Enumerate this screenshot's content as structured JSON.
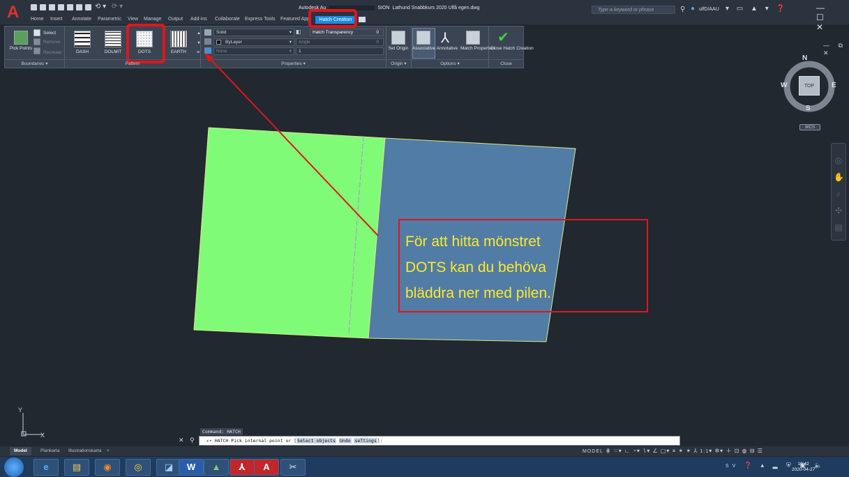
{
  "app": {
    "title_parts": [
      "Autodesk Au",
      "SION",
      "Lathund Snabbkurs 2020 Ulfå egen.dwg"
    ],
    "logo": "A"
  },
  "search": {
    "placeholder": "Type a keyword or phrase"
  },
  "user": {
    "name": "ulfD/AAU"
  },
  "tabs": [
    "Home",
    "Insert",
    "Annotate",
    "Parametric",
    "View",
    "Manage",
    "Output",
    "Add-ins",
    "Collaborate",
    "Express Tools",
    "Featured App"
  ],
  "active_tab": "Hatch Creation",
  "ribbon": {
    "boundaries": {
      "pick_points": "Pick Points",
      "select": "Select",
      "remove": "Remove",
      "recreate": "Recreate",
      "panel_label": "Boundaries ▾"
    },
    "patterns": [
      "DASH",
      "DOLMIT",
      "DOTS",
      "EARTH"
    ],
    "pattern_panel_label": "Pattern",
    "properties": {
      "type": "Solid",
      "transparency_label": "Hatch Transparency",
      "transparency_value": "0",
      "color": "ByLayer",
      "angle_label": "Angle",
      "angle_value": "0",
      "background": "None",
      "scale_value": "1",
      "panel_label": "Properties ▾"
    },
    "origin": {
      "set_origin": "Set Origin",
      "panel_label": "Origin ▾"
    },
    "options": {
      "associative": "Associative",
      "annotative": "Annotative",
      "match_properties": "Match Properties",
      "panel_label": "Options ▾"
    },
    "close": {
      "label": "Close Hatch Creation",
      "panel_label": "Close"
    }
  },
  "viewcube": {
    "n": "N",
    "s": "S",
    "e": "E",
    "w": "W",
    "top": "TOP",
    "wcs": "WCS"
  },
  "command": {
    "history": "Command: HATCH",
    "prompt": "HATCH Pick internal point or [",
    "opt1": "Select objects",
    "opt2": "Undo",
    "opt3": "seTtings",
    "end": "]:"
  },
  "layout_tabs": [
    "Model",
    "Plankarta",
    "Illustrationskarta",
    "+"
  ],
  "status": {
    "model": "MODEL",
    "scale": "1:1"
  },
  "callout": {
    "lines": [
      "För att hitta mönstret",
      "DOTS kan du behöva",
      "bläddra ner med pilen."
    ]
  },
  "taskbar": {
    "lang": "SV",
    "time": "19:42",
    "date": "2020-04-27"
  },
  "colors": {
    "green_hatch": "#80fb78",
    "blue_hatch": "#517ca5",
    "callout_red": "#e0161b",
    "callout_text": "#ffe92a"
  }
}
